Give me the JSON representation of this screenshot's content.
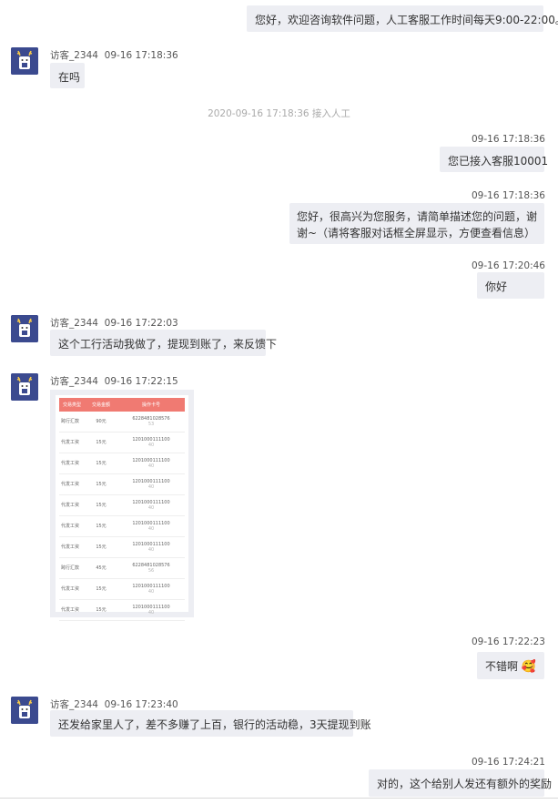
{
  "messages": {
    "m1": {
      "text": "您好，欢迎咨询软件问题，人工客服工作时间每天9:00-22:00。"
    },
    "m2": {
      "sender": "访客_2344",
      "time": "09-16 17:18:36",
      "text": "在吗"
    },
    "sys1": {
      "text": "2020-09-16 17:18:36 接入人工"
    },
    "m3": {
      "time": "09-16 17:18:36",
      "text": "您已接入客服10001"
    },
    "m4": {
      "time": "09-16 17:18:36",
      "text": "您好，很高兴为您服务，请简单描述您的问题，谢谢~（请将客服对话框全屏显示，方便查看信息）"
    },
    "m5": {
      "time": "09-16 17:20:46",
      "text": "你好"
    },
    "m6": {
      "sender": "访客_2344",
      "time": "09-16 17:22:03",
      "text": "这个工行活动我做了，提现到账了，来反馈下"
    },
    "m7": {
      "sender": "访客_2344",
      "time": "09-16 17:22:15"
    },
    "m8": {
      "time": "09-16 17:22:23",
      "text": "不错啊",
      "emoji": "🥰"
    },
    "m9": {
      "sender": "访客_2344",
      "time": "09-16 17:23:40",
      "text": "还发给家里人了，差不多赚了上百，银行的活动稳，3天提现到账"
    },
    "m10": {
      "time": "09-16 17:24:21",
      "text": "对的，这个给别人发还有额外的奖励"
    }
  },
  "screenshot": {
    "headers": [
      "交易类型",
      "交易金额",
      "操作卡号"
    ],
    "rows": [
      {
        "type": "跨行汇款",
        "amount": "90元",
        "card": "6228481028576",
        "card2": "53"
      },
      {
        "type": "代发工资",
        "amount": "15元",
        "card": "1201000111100",
        "card2": "40"
      },
      {
        "type": "代发工资",
        "amount": "15元",
        "card": "1201000111100",
        "card2": "40"
      },
      {
        "type": "代发工资",
        "amount": "15元",
        "card": "1201000111100",
        "card2": "40"
      },
      {
        "type": "代发工资",
        "amount": "15元",
        "card": "1201000111100",
        "card2": "40"
      },
      {
        "type": "代发工资",
        "amount": "15元",
        "card": "1201000111100",
        "card2": "40"
      },
      {
        "type": "代发工资",
        "amount": "15元",
        "card": "1201000111100",
        "card2": "40"
      },
      {
        "type": "跨行汇款",
        "amount": "45元",
        "card": "6228481028576",
        "card2": "56"
      },
      {
        "type": "代发工资",
        "amount": "15元",
        "card": "1201000111100",
        "card2": "40"
      },
      {
        "type": "代发工资",
        "amount": "15元",
        "card": "1201000111100",
        "card2": "40"
      }
    ]
  },
  "colors": {
    "bubble": "#edeef3",
    "avatar": "#3b4a8f",
    "table_header": "#f07a72"
  }
}
